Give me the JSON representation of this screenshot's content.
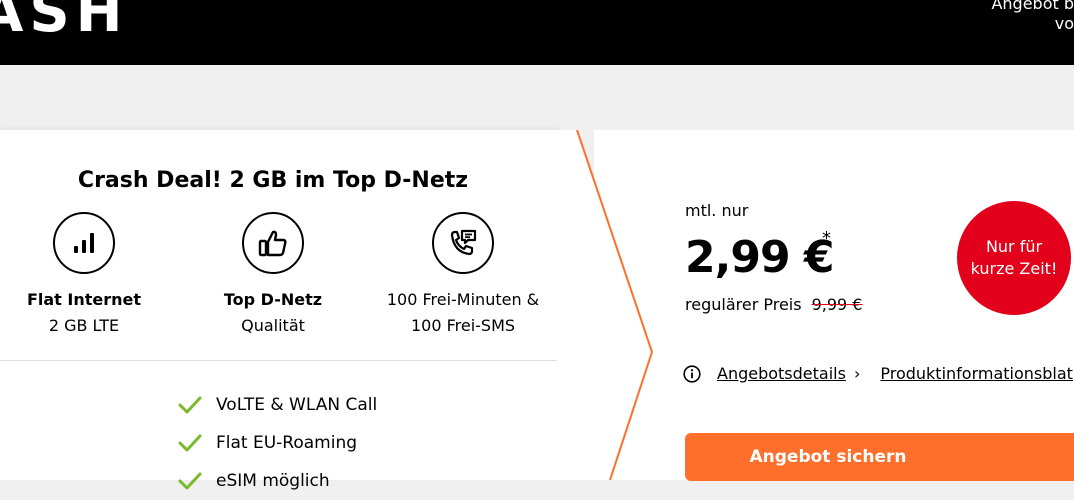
{
  "header": {
    "logo_text": "ASH",
    "right_text_line1": "Angebot b",
    "right_text_line2": "vo"
  },
  "deal": {
    "title": "Crash Deal! 2 GB im Top D-Netz",
    "features": [
      {
        "icon": "signal-bars-icon",
        "line1": "Flat Internet",
        "line2": "2 GB LTE"
      },
      {
        "icon": "thumbs-up-icon",
        "line1": "Top D-Netz",
        "line2": "Qualität"
      },
      {
        "icon": "phone-message-icon",
        "line1": "100 Frei-Minuten &",
        "line2": "100 Frei-SMS"
      }
    ],
    "checks": [
      "VoLTE & WLAN Call",
      "Flat EU-Roaming",
      "eSIM möglich"
    ]
  },
  "pricing": {
    "prefix": "mtl. nur",
    "price": "2,99 €",
    "asterisk": "*",
    "regular_label": "regulärer Preis",
    "regular_price": "9,99 €",
    "badge_line1": "Nur für",
    "badge_line2": "kurze Zeit!"
  },
  "links": {
    "details": "Angebotsdetails",
    "product_info": "Produktinformationsblat"
  },
  "cta": {
    "label": "Angebot sichern"
  },
  "colors": {
    "accent": "#ff6f2c",
    "badge": "#e2001a",
    "check": "#7ab929"
  }
}
